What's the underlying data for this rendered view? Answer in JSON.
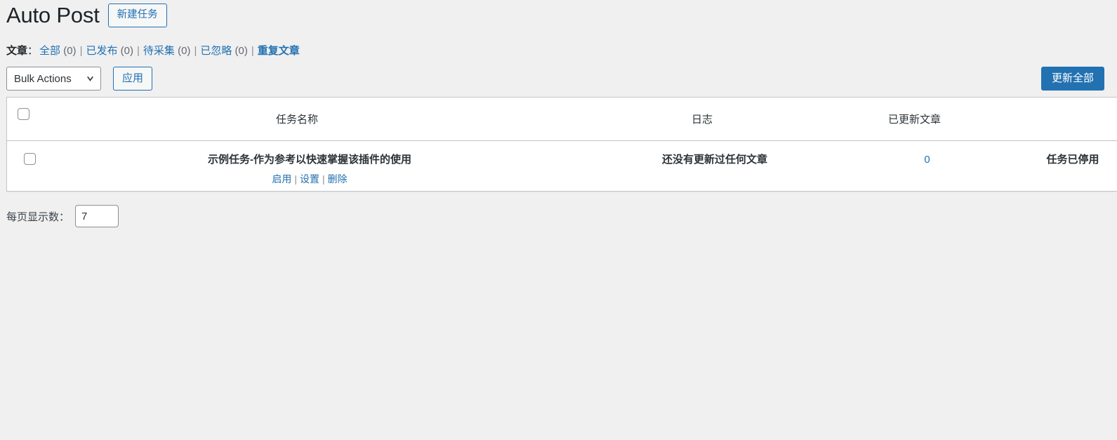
{
  "page": {
    "title": "Auto Post",
    "new_task_button": "新建任务"
  },
  "filters": {
    "label": "文章",
    "colon": "：",
    "separator": "|",
    "items": [
      {
        "label": "全部",
        "count": "(0)"
      },
      {
        "label": "已发布",
        "count": "(0)"
      },
      {
        "label": "待采集",
        "count": "(0)"
      },
      {
        "label": "已忽略",
        "count": "(0)"
      },
      {
        "label": "重复文章",
        "count": ""
      }
    ]
  },
  "toolbar": {
    "bulk_actions_value": "Bulk Actions",
    "apply_label": "应用",
    "update_all_label": "更新全部"
  },
  "table": {
    "columns": [
      {
        "key": "name",
        "label": "任务名称"
      },
      {
        "key": "log",
        "label": "日志"
      },
      {
        "key": "count",
        "label": "已更新文章"
      },
      {
        "key": "status",
        "label": ""
      }
    ],
    "rows": [
      {
        "name": "示例任务-作为参考以快速掌握该插件的使用",
        "actions": [
          "启用",
          "设置",
          "删除"
        ],
        "action_separator": "|",
        "log": "还没有更新过任何文章",
        "count": "0",
        "status": "任务已停用"
      }
    ]
  },
  "footer": {
    "per_page_label": "每页显示数：",
    "per_page_value": "7"
  },
  "colors": {
    "page_background": "#f0f0f1",
    "accent_blue": "#2271b1",
    "text_dark": "#1d2327",
    "text_body": "#3c434a",
    "muted": "#646970",
    "border": "#c3c4c7",
    "surface": "#ffffff"
  },
  "icons": {
    "chevron_down": "chevron-down-icon"
  }
}
